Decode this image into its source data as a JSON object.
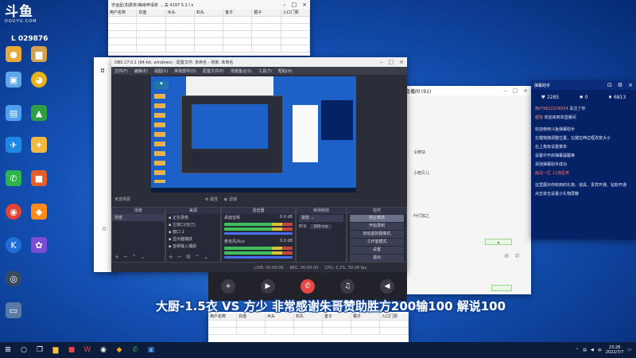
{
  "brand": {
    "logo_text": "斗鱼",
    "logo_url": "DOUYU.COM",
    "room_id": "L 029876"
  },
  "spreadsheet_top": {
    "title": "字运星(扣费单)等级申请单 ... 关 4197 S 2 I x",
    "columns": [
      "用户名称",
      "充值",
      "木头",
      "石头",
      "金子",
      "银子",
      "入口门票"
    ]
  },
  "spreadsheet_bottom": {
    "columns": [
      "用户名称",
      "充值",
      "木头",
      "石头",
      "金子",
      "银子",
      "入口门票"
    ]
  },
  "obs": {
    "title": "OBS 27.0.1 (64-bit, windows) - 配置文件: 未命名 - 场景: 未命名",
    "menu": [
      "文件(F)",
      "编辑(E)",
      "视图(V)",
      "停靠部件(D)",
      "配置文件(P)",
      "场景集合(S)",
      "工具(T)",
      "帮助(H)"
    ],
    "source_bar_label": "未选择源",
    "source_bar_props": "属性",
    "source_bar_filters": "滤镜",
    "panels": {
      "scenes": "场景",
      "sources": "来源",
      "mixer": "混音器",
      "transitions": "转场特效",
      "controls": "控件"
    },
    "scene_item": "场景",
    "source_items": [
      "正在录像",
      "主窗口(自己)",
      "窗口 2",
      "显示器捕获",
      "音频输入捕获"
    ],
    "mixer_items": [
      {
        "name": "桌面音频",
        "db": "0.0 dB"
      },
      {
        "name": "麦克风/Aux",
        "db": "0.0 dB"
      }
    ],
    "transition_name": "渐变",
    "transition_duration_label": "时长",
    "transition_duration_value": "300 ms",
    "control_buttons": [
      "停止推流",
      "开始录制",
      "启动虚拟摄像机",
      "工作室模式",
      "设置",
      "退出"
    ],
    "status": [
      "LIVE: 00:00:00",
      "REC: 00:00:00",
      "CPU: 3.2%, 30.00 fps"
    ]
  },
  "chat_window": {
    "title": "弹幕助手",
    "stats": [
      {
        "icon": "heart-icon",
        "value": "2285"
      },
      {
        "icon": "fire-icon",
        "value": "0"
      },
      {
        "icon": "gift-icon",
        "value": "6813"
      }
    ],
    "messages": [
      {
        "user": "用户5612276554",
        "text": "关注了你"
      },
      {
        "user": "超管",
        "text": "欢迎来到本直播间"
      },
      {
        "user": "",
        "text": "欢迎使用斗鱼弹幕助手"
      },
      {
        "user": "",
        "text": "左键拖拽调整位置，左键拉伸边框改变大小"
      },
      {
        "user": "",
        "text": "右上角有设置菜单"
      },
      {
        "user": "",
        "text": "设置中开启弹幕提醒等"
      },
      {
        "user": "",
        "text": "添加弹幕助手成功"
      },
      {
        "user": "魔战一区",
        "text": "11满星英",
        "red": true
      },
      {
        "user": "",
        "text": "这里展示你收到的礼物、道具、贵宾开通、钻粉开通"
      },
      {
        "user": "",
        "text": "点击单击设置小礼物屏蔽"
      }
    ]
  },
  "room_panel": {
    "title": "直播间 (91)",
    "hint": "令牌块",
    "name": "小丽贝儿",
    "hint2": "叶们加之"
  },
  "callbar": {
    "buttons": [
      "add-icon",
      "camera-icon",
      "hangup-icon",
      "mic-icon",
      "speaker-icon"
    ]
  },
  "subtitle": "大厨-1.5衣 VS 方少 非常感谢朱哥赞助胜方200输100 解说100",
  "taskbar": {
    "time": "23:28",
    "date": "2022/7/7"
  }
}
